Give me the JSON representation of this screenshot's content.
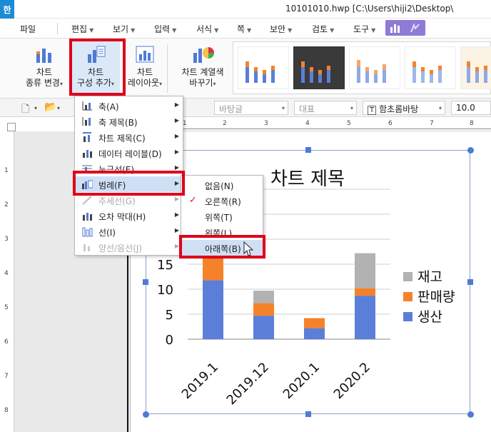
{
  "window": {
    "app_logo": "한",
    "title": "10101010.hwp [C:\\Users\\hiji2\\Desktop\\"
  },
  "menubar": {
    "items": [
      "파일",
      "편집",
      "보기",
      "입력",
      "서식",
      "쪽",
      "보안",
      "검토",
      "도구"
    ]
  },
  "ribbon": {
    "buttons": [
      {
        "line1": "차트",
        "line2": "종류 변경"
      },
      {
        "line1": "차트",
        "line2": "구성 추가"
      },
      {
        "line1": "차트",
        "line2": "레이아웃"
      },
      {
        "line1": "차트 계열색",
        "line2": "바꾸기"
      }
    ]
  },
  "toolbar2": {
    "style_combo": "바탕글",
    "outline_combo": "대표",
    "font_combo": "함초롬바탕",
    "size_combo": "10.0",
    "font_prefix": "T"
  },
  "ruler": {
    "h_labels": [
      "1",
      "2",
      "3",
      "4",
      "5",
      "6",
      "7",
      "8"
    ],
    "v_labels": [
      "1",
      "2",
      "3",
      "4",
      "5",
      "6",
      "7",
      "8"
    ]
  },
  "dropdown": {
    "items": [
      {
        "label": "축(A)",
        "disabled": false
      },
      {
        "label": "축 제목(B)",
        "disabled": false
      },
      {
        "label": "차트 제목(C)",
        "disabled": false
      },
      {
        "label": "데이터 레이블(D)",
        "disabled": false
      },
      {
        "label": "눈금선(E)",
        "disabled": false
      },
      {
        "label": "범례(F)",
        "disabled": false
      },
      {
        "label": "추세선(G)",
        "disabled": true
      },
      {
        "label": "오차 막대(H)",
        "disabled": false
      },
      {
        "label": "선(I)",
        "disabled": false
      },
      {
        "label": "양선/음선(J)",
        "disabled": true
      }
    ]
  },
  "submenu": {
    "items": [
      "없음(N)",
      "오른쪽(R)",
      "위쪽(T)",
      "왼쪽(L)",
      "아래쪽(B)"
    ],
    "checked": "오른쪽(R)",
    "hovered": "아래쪽(B)"
  },
  "chart_data": {
    "type": "bar",
    "stacked": true,
    "title": "차트 제목",
    "categories": [
      "2019.1",
      "2019.12",
      "2020.1",
      "2020.2"
    ],
    "series": [
      {
        "name": "생산",
        "color": "#5b7fd9",
        "values": [
          11.8,
          4.7,
          2.2,
          8.7
        ]
      },
      {
        "name": "판매량",
        "color": "#f5822a",
        "values": [
          7,
          2.5,
          2,
          1.5
        ]
      },
      {
        "name": "재고",
        "color": "#b2b2b2",
        "values": [
          0,
          2.5,
          0,
          7
        ]
      }
    ],
    "y_ticks": [
      "0",
      "5",
      "10",
      "15"
    ],
    "ylim": [
      0,
      30
    ],
    "legend_position": "right",
    "grid": true
  },
  "colors": {
    "highlight": "#cfe0f5",
    "red_box": "#e0001a",
    "tab_active": "#8d7bd6",
    "handle": "#4f7ad6"
  }
}
